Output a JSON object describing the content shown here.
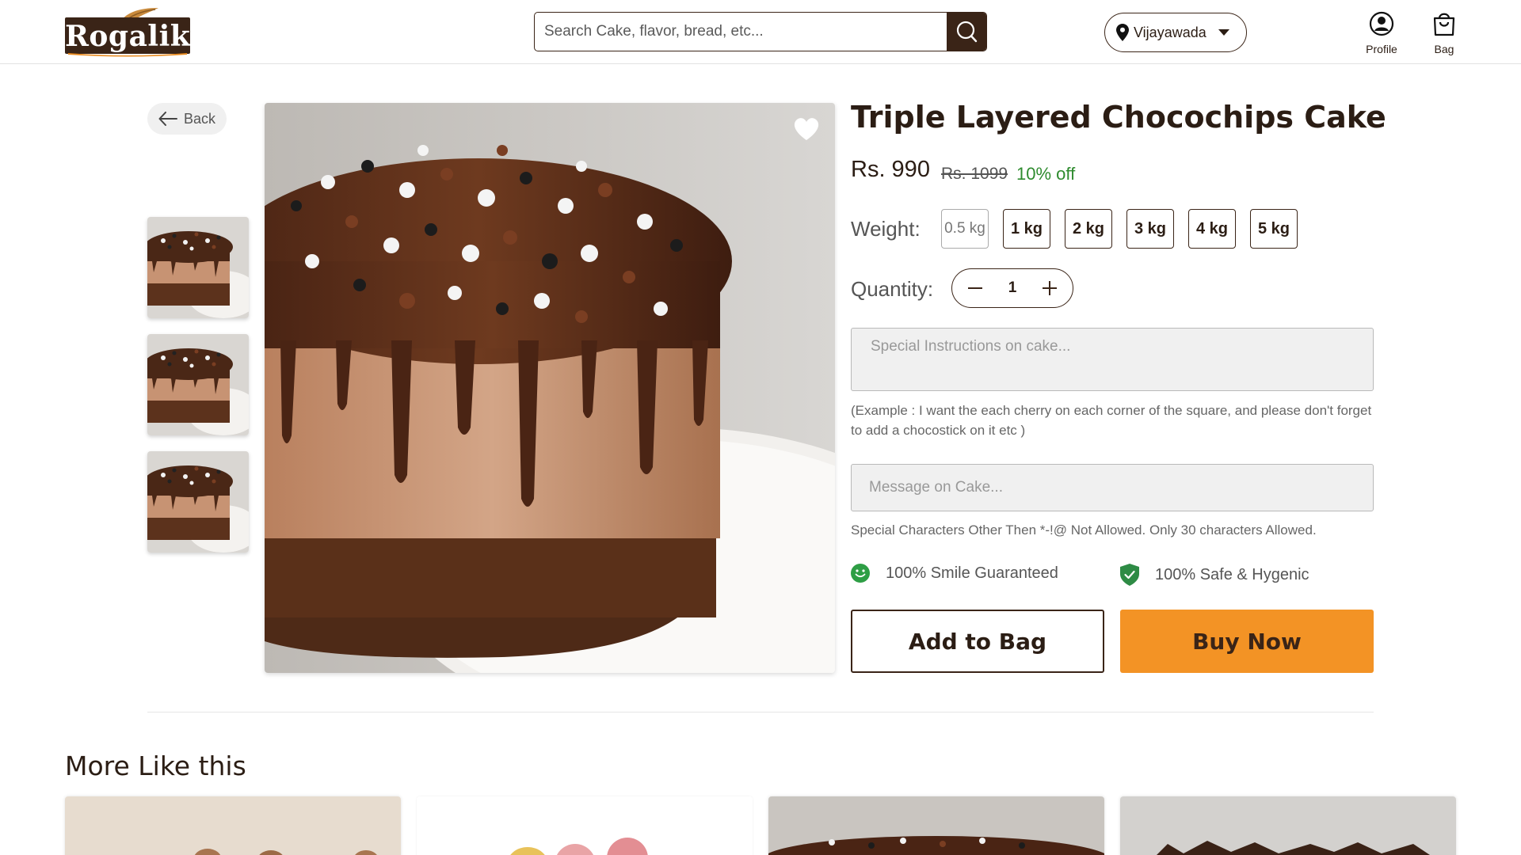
{
  "header": {
    "logo_text": "Rogalik",
    "search_placeholder": "Search Cake, flavor, bread, etc...",
    "location": "Vijayawada",
    "profile_label": "Profile",
    "bag_label": "Bag"
  },
  "product": {
    "back_label": "Back",
    "title": "Triple Layered Chocochips Cake",
    "price": "Rs. 990",
    "old_price": "Rs. 1099",
    "discount": "10% off",
    "weight_label": "Weight:",
    "weights": [
      "0.5 kg",
      "1 kg",
      "2 kg",
      "3 kg",
      "4 kg",
      "5 kg"
    ],
    "quantity_label": "Quantity:",
    "quantity": "1",
    "instructions_placeholder": "Special Instructions on cake...",
    "instructions_example": "(Example : I want the each cherry on each corner of the square, and please don't forget to add a chocostick on it etc )",
    "message_placeholder": "Message on Cake...",
    "message_note": "Special Characters Other Then *-!@ Not Allowed. Only 30 characters Allowed.",
    "guarantee_smile": "100% Smile Guaranteed",
    "guarantee_safe": "100% Safe & Hygenic",
    "add_to_bag": "Add to Bag",
    "buy_now": "Buy Now"
  },
  "more": {
    "title": "More Like this"
  },
  "colors": {
    "brand_dark": "#3a2417",
    "accent_orange": "#f39325",
    "discount_green": "#2e8b2e"
  }
}
